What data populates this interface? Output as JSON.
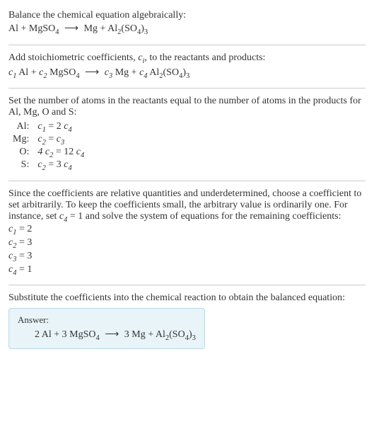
{
  "s1": {
    "title": "Balance the chemical equation algebraically:",
    "eq_lhs": "Al + MgSO",
    "eq_rhs": "Mg + Al",
    "so4": "(SO",
    "close3": ")"
  },
  "s2": {
    "text_a": "Add stoichiometric coefficients, ",
    "ci": "c",
    "isub": "i",
    "text_b": ", to the reactants and products:",
    "c1": "c",
    "n1": "1",
    "Al": " Al + ",
    "c2": "c",
    "n2": "2",
    "MgSO4": " MgSO",
    "arrow_to": "  ⟶  ",
    "c3": "c",
    "n3": "3",
    "Mg": " Mg + ",
    "c4": "c",
    "n4": "4",
    "Al2": " Al"
  },
  "s3": {
    "intro": "Set the number of atoms in the reactants equal to the number of atoms in the products for Al, Mg, O and S:",
    "rows": [
      {
        "el": "Al:",
        "c": "c",
        "lsub": "1",
        "mid": " = 2 ",
        "c2": "c",
        "rsub": "4"
      },
      {
        "el": "Mg:",
        "c": "c",
        "lsub": "2",
        "mid": " = ",
        "c2": "c",
        "rsub": "3"
      },
      {
        "el": "O:",
        "c": "4 c",
        "lsub": "2",
        "mid": " = 12 ",
        "c2": "c",
        "rsub": "4"
      },
      {
        "el": "S:",
        "c": "c",
        "lsub": "2",
        "mid": " = 3 ",
        "c2": "c",
        "rsub": "4"
      }
    ]
  },
  "s4": {
    "intro_a": "Since the coefficients are relative quantities and underdetermined, choose a coefficient to set arbitrarily. To keep the coefficients small, the arbitrary value is ordinarily one. For instance, set ",
    "c4": "c",
    "n4": "4",
    "eq1": " = 1",
    "intro_b": " and solve the system of equations for the remaining coefficients:",
    "lines": [
      {
        "c": "c",
        "sub": "1",
        "val": " = 2"
      },
      {
        "c": "c",
        "sub": "2",
        "val": " = 3"
      },
      {
        "c": "c",
        "sub": "3",
        "val": " = 3"
      },
      {
        "c": "c",
        "sub": "4",
        "val": " = 1"
      }
    ]
  },
  "s5": {
    "text": "Substitute the coefficients into the chemical reaction to obtain the balanced equation:"
  },
  "answer": {
    "label": "Answer:",
    "lhs": "2 Al + 3 MgSO",
    "rhs": "3 Mg + Al"
  },
  "sub4": "4",
  "sub2": "2",
  "sub3": "3",
  "arrow": "⟶"
}
